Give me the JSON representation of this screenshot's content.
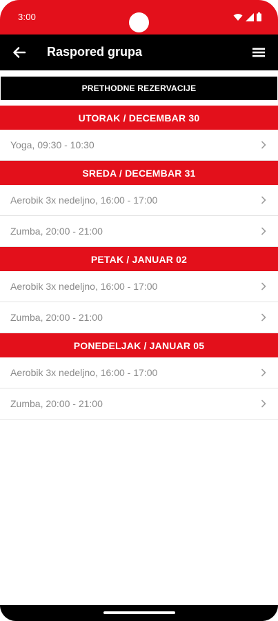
{
  "status": {
    "time": "3:00"
  },
  "app_bar": {
    "title": "Raspored grupa"
  },
  "previous_button": "PRETHODNE REZERVACIJE",
  "days": [
    {
      "header": "UTORAK / DECEMBAR 30",
      "items": [
        "Yoga, 09:30 - 10:30"
      ]
    },
    {
      "header": "SREDA / DECEMBAR 31",
      "items": [
        "Aerobik 3x nedeljno, 16:00 - 17:00",
        "Zumba, 20:00 - 21:00"
      ]
    },
    {
      "header": "PETAK / JANUAR 02",
      "items": [
        "Aerobik 3x nedeljno, 16:00 - 17:00",
        "Zumba, 20:00 - 21:00"
      ]
    },
    {
      "header": "PONEDELJAK / JANUAR 05",
      "items": [
        "Aerobik 3x nedeljno, 16:00 - 17:00",
        "Zumba, 20:00 - 21:00"
      ]
    }
  ],
  "colors": {
    "brand_red": "#e3101b",
    "bar_black": "#000000",
    "item_text": "#8a8a8a"
  },
  "icons": [
    "wifi-icon",
    "signal-icon",
    "battery-icon",
    "back-arrow-icon",
    "hamburger-menu-icon",
    "chevron-right-icon"
  ]
}
